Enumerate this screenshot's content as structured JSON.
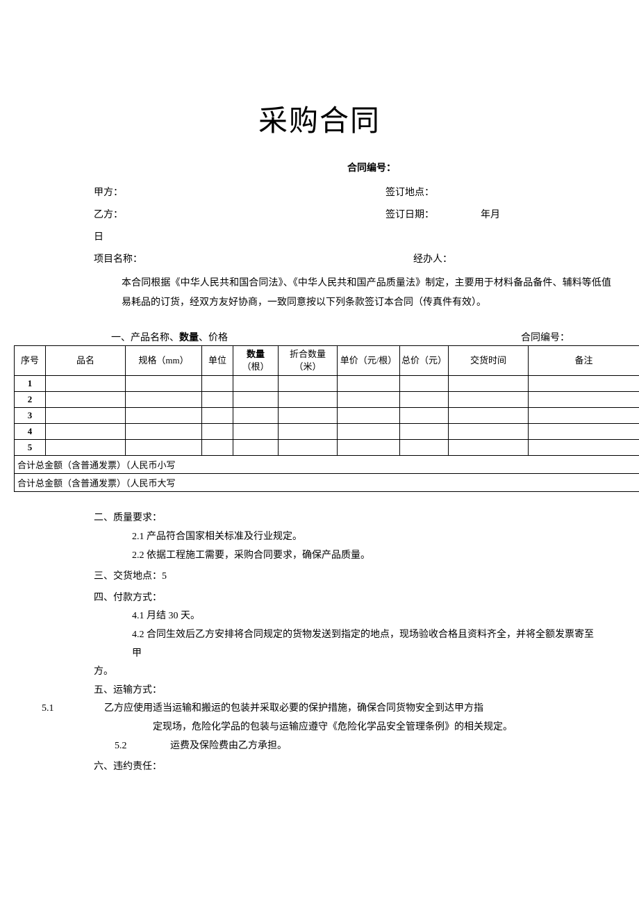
{
  "title": "采购合同",
  "contract_no_label": "合同编号：",
  "header": {
    "party_a_label": "甲方：",
    "sign_place_label": "签订地点：",
    "party_b_label": "乙方：",
    "sign_date_label": "签订日期：",
    "sign_date_value": "年月",
    "day_label": "日",
    "project_label": "项目名称：",
    "handler_label": "经办人："
  },
  "intro": "本合同根据《中华人民共和国合同法》、《中华人民共和国产品质量法》制定，主要用于材料备品备件、辅料等低值易耗品的订货，经双方友好协商，一致同意按以下列条款签订本合同（传真件有效）。",
  "section1": {
    "title_prefix": "一、产品名称、",
    "title_bold": "数量",
    "title_suffix": "、价格",
    "contract_no_label": "合同编号："
  },
  "table": {
    "headers": {
      "seq": "序号",
      "name": "品名",
      "spec": "规格（mm）",
      "unit": "单位",
      "qty": "数量",
      "qty_unit": "（根）",
      "conv_qty": "折合数量（米）",
      "price": "单价（元/根）",
      "total": "总价（元）",
      "delivery": "交货时间",
      "remark": "备注"
    },
    "rows": [
      "1",
      "2",
      "3",
      "4",
      "5"
    ],
    "sum_lower": "合计总金额（含普通发票）（人民币小写",
    "sum_upper": "合计总金额（含普通发票）（人民币大写"
  },
  "section2": {
    "title": "二、质量要求：",
    "item1": "2.1   产品符合国家相关标准及行业规定。",
    "item2": "2.2   依据工程施工需要，采购合同要求，确保产品质量。"
  },
  "section3": "三、交货地点：5",
  "section4": {
    "title": "四、付款方式：",
    "item1": "4.1   月结 30 天。",
    "item2": "4.2   合同生效后乙方安排将合同规定的货物发送到指定的地点，现场验收合格且资料齐全，并将全额发票寄至甲",
    "item2_cont": "方。"
  },
  "section5": {
    "title": "五、运输方式：",
    "item1_no": "5.1",
    "item1_text": "乙方应使用适当运输和搬运的包装并采取必要的保护措施，确保合同货物安全到达甲方指",
    "item1_cont": "定现场，危险化学品的包装与运输应遵守《危险化学品安全管理条例》的相关规定。",
    "item2_no": "5.2",
    "item2_text": "运费及保险费由乙方承担。"
  },
  "section6": "六、违约责任："
}
